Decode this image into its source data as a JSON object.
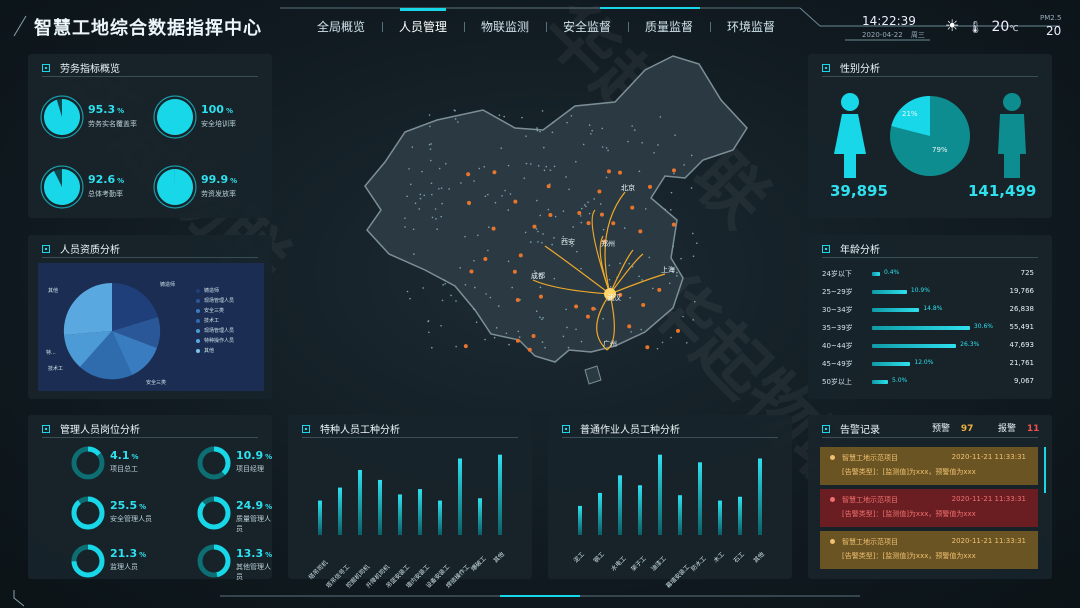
{
  "header": {
    "title": "智慧工地综合数据指挥中心",
    "nav": [
      {
        "label": "全局概览",
        "active": false
      },
      {
        "label": "人员管理",
        "active": true
      },
      {
        "label": "物联监测",
        "active": false
      },
      {
        "label": "安全监督",
        "active": false
      },
      {
        "label": "质量监督",
        "active": false
      },
      {
        "label": "环境监督",
        "active": false
      }
    ],
    "time": "14:22:39",
    "date": "2020-04-22",
    "weekday": "周三",
    "weather_icon": "sun-icon",
    "temperature": "20",
    "temp_unit": "℃",
    "pm_label": "PM2.5",
    "pm_value": "20"
  },
  "labor": {
    "title": "劳务指标概览",
    "items": [
      {
        "value": "95.3",
        "unit": "%",
        "label": "劳务实名覆盖率",
        "fraction": 0.953
      },
      {
        "value": "100",
        "unit": "%",
        "label": "安全培训率",
        "fraction": 1.0
      },
      {
        "value": "92.6",
        "unit": "%",
        "label": "总体考勤率",
        "fraction": 0.926
      },
      {
        "value": "99.9",
        "unit": "%",
        "label": "劳资发放率",
        "fraction": 0.999
      }
    ]
  },
  "quals": {
    "title": "人员资质分析",
    "slice_labels": [
      "其他",
      "铸造师",
      "现场管理人员",
      "安全三类",
      "技术工",
      "现场管理人员",
      "特种操作人员",
      "其他",
      "技术工",
      "安全三类",
      "特..."
    ],
    "legend": [
      "铸造师",
      "现场管理人员",
      "安全三类",
      "技术工",
      "现场管理人员",
      "特种操作人员",
      "其他"
    ],
    "outer_labels": [
      "其他",
      "铸造师",
      "特...",
      "技术工",
      "安全三类"
    ]
  },
  "mgmt": {
    "title": "管理人员岗位分析",
    "items": [
      {
        "value": "4.1",
        "unit": "%",
        "label": "项目总工",
        "fraction": 0.041
      },
      {
        "value": "10.9",
        "unit": "%",
        "label": "项目经理",
        "fraction": 0.109
      },
      {
        "value": "25.5",
        "unit": "%",
        "label": "安全管理人员",
        "fraction": 0.255
      },
      {
        "value": "24.9",
        "unit": "%",
        "label": "质量管理人员",
        "fraction": 0.249
      },
      {
        "value": "21.3",
        "unit": "%",
        "label": "监理人员",
        "fraction": 0.213
      },
      {
        "value": "13.3",
        "unit": "%",
        "label": "其他管理人员",
        "fraction": 0.133
      }
    ]
  },
  "special": {
    "title": "特种人员工种分析",
    "categories": [
      "塔吊司机",
      "塔吊信号工",
      "挖掘机司机",
      "升降机司机",
      "吊篮安装工",
      "墙内安装工",
      "设备安装工",
      "焊接操作工",
      "爆破工",
      "其他"
    ],
    "values": [
      0.45,
      0.62,
      0.85,
      0.72,
      0.53,
      0.6,
      0.45,
      1.0,
      0.48,
      1.05
    ]
  },
  "normal": {
    "title": "普通作业人员工种分析",
    "categories": [
      "泥工",
      "钢工",
      "水电工",
      "架子工",
      "油漆工",
      "幕墙安装工",
      "防水工",
      "木工",
      "石工",
      "其他"
    ],
    "values": [
      0.38,
      0.55,
      0.78,
      0.65,
      1.05,
      0.52,
      0.95,
      0.45,
      0.5,
      1.0
    ]
  },
  "map": {
    "cities": [
      "北京",
      "西安",
      "成都",
      "郑州",
      "上海",
      "武汉",
      "广州"
    ]
  },
  "gender": {
    "title": "性别分析",
    "female": "39,895",
    "male": "141,499",
    "female_pct": "21%",
    "male_pct": "79%",
    "female_fraction": 0.21,
    "female_icon": "female-person-icon",
    "male_icon": "male-person-icon"
  },
  "age": {
    "title": "年龄分析",
    "rows": [
      {
        "label": "24岁以下",
        "pct": "0.4%",
        "value": "725",
        "fraction": 0.004
      },
      {
        "label": "25~29岁",
        "pct": "10.9%",
        "value": "19,766",
        "fraction": 0.109
      },
      {
        "label": "30~34岁",
        "pct": "14.8%",
        "value": "26,838",
        "fraction": 0.148
      },
      {
        "label": "35~39岁",
        "pct": "30.6%",
        "value": "55,491",
        "fraction": 0.306
      },
      {
        "label": "40~44岁",
        "pct": "26.3%",
        "value": "47,693",
        "fraction": 0.263
      },
      {
        "label": "45~49岁",
        "pct": "12.0%",
        "value": "21,761",
        "fraction": 0.12
      },
      {
        "label": "50岁以上",
        "pct": "5.0%",
        "value": "9,067",
        "fraction": 0.05
      }
    ]
  },
  "alarm": {
    "title": "告警记录",
    "warn_label": "预警",
    "warn_count": "97",
    "alert_label": "报警",
    "alert_count": "11",
    "items": [
      {
        "name": "智慧工地示范项目",
        "time": "2020-11-21 11:33:31",
        "detail": "[告警类型]：[监测值]为xxx，预警值为xxx",
        "level": "warn",
        "bg": "#6a5423",
        "fg": "#f0c070"
      },
      {
        "name": "智慧工地示范项目",
        "time": "2020-11-21 11:33:31",
        "detail": "[告警类型]：[监测值]为xxx，预警值为xxx",
        "level": "alert",
        "bg": "#6b1e22",
        "fg": "#f07070"
      },
      {
        "name": "智慧工地示范项目",
        "time": "2020-11-21 11:33:31",
        "detail": "[告警类型]：[监测值]为xxx，预警值为xxx",
        "level": "warn",
        "bg": "#6a5423",
        "fg": "#f0c070"
      }
    ]
  },
  "watermark": "华起物联",
  "colors": {
    "accent": "#18d7e8",
    "teal_dark": "#0d8d8f",
    "pie_dark": "#1e3f7a",
    "pie_mid": "#2e6bb0",
    "pie_light": "#4a9ad8"
  }
}
